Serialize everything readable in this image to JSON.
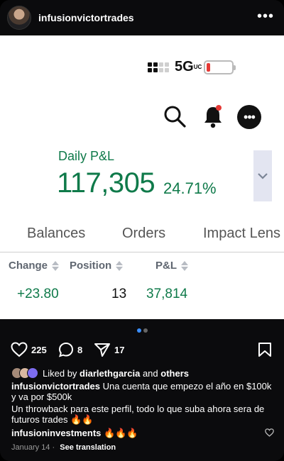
{
  "post": {
    "username": "infusionvictortrades",
    "more_icon": "more-dots-icon"
  },
  "screenshot": {
    "network": "5G",
    "network_suffix": "UC",
    "battery_level": 0.15,
    "daily_pl_label": "Daily P&L",
    "daily_pl_value": "117,305",
    "daily_pl_pct": "24.71%",
    "expand_icon": "chevron-down-icon",
    "tabs": [
      "Balances",
      "Orders",
      "Impact Lens"
    ],
    "columns": [
      "Change",
      "Position",
      "P&L"
    ],
    "row": {
      "change": "+23.80",
      "position": "13",
      "pl": "37,814"
    },
    "colors": {
      "green": "#0f7a4a",
      "battery_red": "#e53935"
    }
  },
  "actions": {
    "likes": "225",
    "comments": "8",
    "shares": "17"
  },
  "liked_by": {
    "prefix": "Liked by",
    "user": "diarlethgarcia",
    "conj": "and",
    "others": "others"
  },
  "caption": {
    "user": "infusionvictortrades",
    "text": "Una cuenta que empezo el año en $100k y va por $500k",
    "text2": "Un throwback para este perfil, todo lo que suba ahora sera de futuros trades 🔥🔥"
  },
  "comment": {
    "user": "infusioninvestments",
    "text": "🔥🔥🔥"
  },
  "meta": {
    "date": "January 14",
    "separator": "·",
    "see_translation": "See translation"
  }
}
